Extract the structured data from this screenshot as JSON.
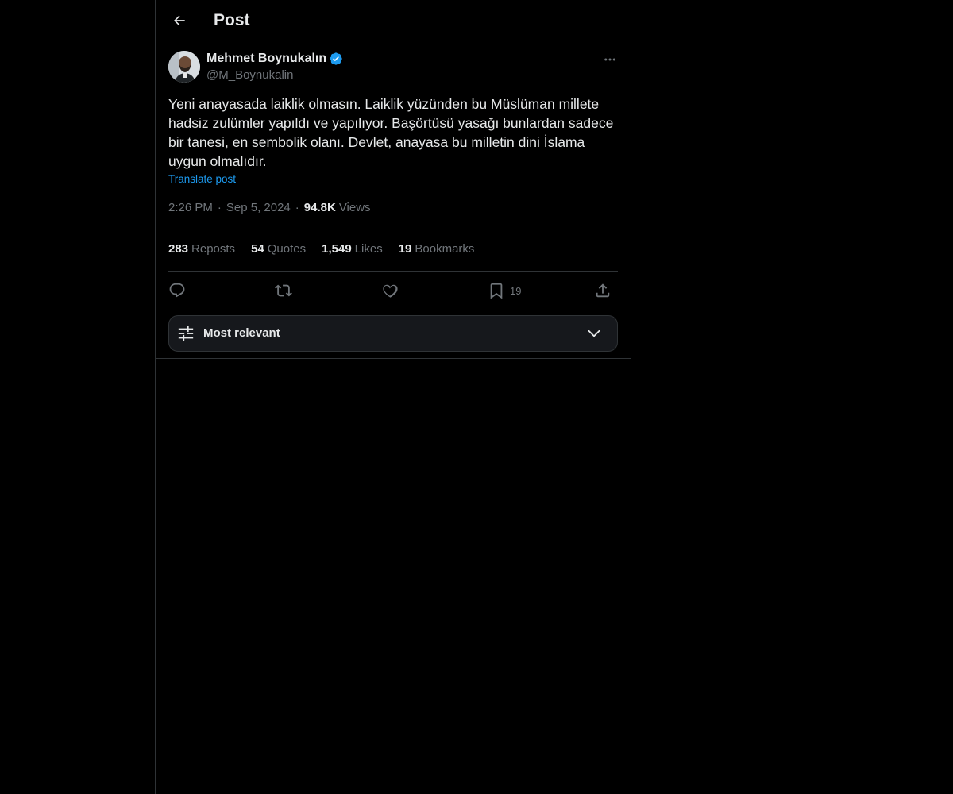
{
  "header": {
    "title": "Post"
  },
  "post": {
    "author_name": "Mehmet Boynukalın",
    "author_handle": "@M_Boynukalin",
    "text": "Yeni anayasada laiklik olmasın. Laiklik yüzünden bu Müslüman millete hadsiz zulümler yapıldı ve yapılıyor. Başörtüsü yasağı bunlardan sadece bir tanesi, en sembolik olanı. Devlet, anayasa bu milletin dini İslama uygun olmalıdır.",
    "translate_label": "Translate post",
    "time": "2:26 PM",
    "date": "Sep 5, 2024",
    "views_count": "94.8K",
    "views_label": "Views",
    "separator": "·"
  },
  "stats": {
    "reposts_count": "283",
    "reposts_label": "Reposts",
    "quotes_count": "54",
    "quotes_label": "Quotes",
    "likes_count": "1,549",
    "likes_label": "Likes",
    "bookmarks_count": "19",
    "bookmarks_label": "Bookmarks"
  },
  "actions": {
    "bookmark_count": "19",
    "icons": [
      "reply-icon",
      "repost-icon",
      "like-icon",
      "bookmark-icon",
      "share-icon"
    ]
  },
  "sort": {
    "label": "Most relevant"
  },
  "colors": {
    "accent": "#1d9bf0",
    "background": "#000000",
    "border": "#2f3336",
    "muted": "#71767b",
    "text": "#e7e9ea"
  }
}
